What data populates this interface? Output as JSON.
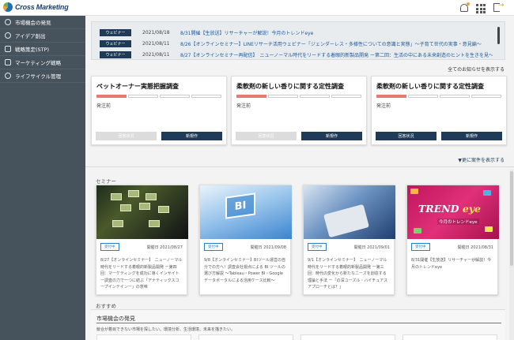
{
  "app": {
    "logo_text": "Cross Marketing"
  },
  "header_icons": [
    "bell-icon",
    "apps-grid-icon",
    "logout-icon"
  ],
  "colors": {
    "sidebar": "#46525c",
    "navy": "#1f3b57",
    "accent_progress": "#e67a74",
    "link": "#1d5a9e"
  },
  "sidebar": {
    "items": [
      {
        "label": "市場機会の発見",
        "icon": "discovery-icon"
      },
      {
        "label": "アイデア創出",
        "icon": "idea-icon"
      },
      {
        "label": "戦略策定(STP)",
        "icon": "strategy-icon"
      },
      {
        "label": "マーケティング戦略",
        "icon": "marketing-icon"
      },
      {
        "label": "ライフサイクル管理",
        "icon": "lifecycle-icon"
      }
    ]
  },
  "news": {
    "items": [
      {
        "badge": "ウェビナー",
        "date": "2021/08/18",
        "title": "8/31開催【生放送】リサーチャーが解説！今月のトレンドeye"
      },
      {
        "badge": "ウェビナー",
        "date": "2021/08/11",
        "title": "8/26【オンラインセミナー】LINEリサーチ活用ウェビナー「ジェンダーレス・多様性についての意識と実態」～子育て世代の実事・意見編～"
      },
      {
        "badge": "ウェビナー",
        "date": "2021/08/11",
        "title": "8/27【オンラインセミナー再配信】　ニューノーマル時代をリードする着眼的新製品開発 ー第二回：生活の中にある未来創造のヒントを生きを見～"
      }
    ],
    "all_link": "全てのお知らせを表示する"
  },
  "projects": {
    "items": [
      {
        "title": "ペットオーナー実態把握調査",
        "status": "発注前",
        "progress": "1/4",
        "btn1": "回答状況",
        "btn2": "新規作",
        "btn1_disabled": true
      },
      {
        "title": "柔軟剤の新しい香りに関する定性調査",
        "status": "発注前",
        "progress": "1/4",
        "btn1": "回答状況",
        "btn2": "新規作",
        "btn1_disabled": true
      },
      {
        "title": "柔軟剤の新しい香りに関する定性調査",
        "status": "発注前",
        "progress": "1/4",
        "btn1": "回答状況",
        "btn2": "新規作",
        "btn1_disabled": false
      }
    ],
    "more_link": "▼更に案件を表示する"
  },
  "seminars": {
    "section_label": "セミナー",
    "items": [
      {
        "badge": "受付中",
        "date": "開催日 2021/08/27",
        "desc": "8/27【オンラインセミナー】　ニューノーマル時代をリードする着眼的新製品開発 ー第四回：マーケティングを成功に導くインサイトー調査の力で一つに結ぶ「アナティックスコープインテインー」の意味"
      },
      {
        "badge": "受付中",
        "date": "開催日 2021/09/08",
        "desc": "9/8【オンラインセミナー】BIツール運営の自分での方へ！調査会社視点による BI ツールの選び方解説 ～Tableau・Power BI・Google データポータルによる活用ケース比較～"
      },
      {
        "badge": "受付中",
        "date": "開催日 2021/09/01",
        "desc": "9/1【オンラインセミナー】　ニューノーマル時代をリードする着眼的新製品開発 ー第三回：時代の変化から新たなニーズを創造する理論と手法 ー「の深ユーズル・ハイチュアスアプローチとは？」"
      },
      {
        "badge": "受付中",
        "date": "開催日 2021/08/31",
        "desc": "8/31開催【生放送】リサーチャーが解説！今月のトレンドeye",
        "trend_title": "TREND",
        "trend_eye": "eye",
        "trend_sub": "今月のトレンドeye"
      }
    ]
  },
  "recommend": {
    "label": "おすすめ",
    "section_title": "市場機会の発見",
    "description": "競合が着目できない市場を探したい、環境分析、生活環境、未来を描きたい。"
  }
}
